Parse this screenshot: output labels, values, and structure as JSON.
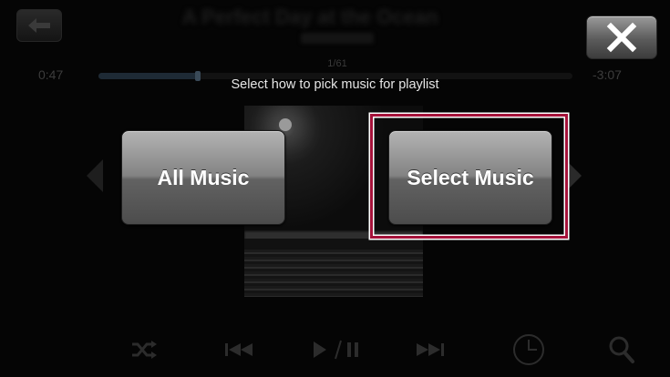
{
  "player": {
    "title": "A Perfect Day at the Ocean",
    "time_elapsed": "0:47",
    "time_remaining": "-3:07",
    "track_count": "1/61",
    "progress": 0.21
  },
  "dialog": {
    "prompt": "Select how to pick music for playlist",
    "options": [
      {
        "label": "All Music"
      },
      {
        "label": "Select Music"
      }
    ]
  },
  "icons": {
    "back": "back-arrow-icon",
    "close": "close-x-icon",
    "shuffle": "shuffle-icon",
    "previous": "previous-track-icon",
    "play_pause": "play-pause-icon",
    "next": "next-track-icon",
    "timer": "clock-icon",
    "search": "search-icon"
  },
  "colors": {
    "highlight": "#a5123a"
  }
}
